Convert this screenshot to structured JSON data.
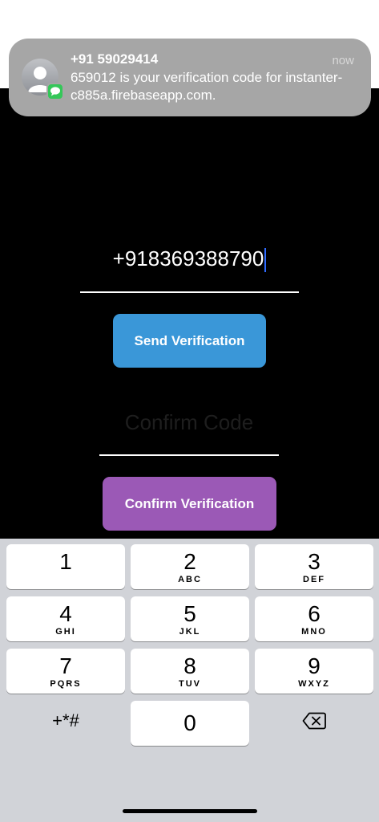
{
  "notification": {
    "sender": "+91 59029414",
    "time": "now",
    "message": "659012 is your verification code for instanter-c885a.firebaseapp.com.",
    "avatar_icon": "contact-avatar-icon",
    "app_badge_icon": "messages-icon"
  },
  "phone": {
    "value": "+918369388790"
  },
  "send_button": {
    "label": "Send Verification",
    "color": "#3a97d8"
  },
  "code": {
    "placeholder": "Confirm Code"
  },
  "confirm_button": {
    "label": "Confirm Verification",
    "color": "#9b59b6"
  },
  "keypad": {
    "keys": [
      {
        "digit": "1",
        "letters": ""
      },
      {
        "digit": "2",
        "letters": "ABC"
      },
      {
        "digit": "3",
        "letters": "DEF"
      },
      {
        "digit": "4",
        "letters": "GHI"
      },
      {
        "digit": "5",
        "letters": "JKL"
      },
      {
        "digit": "6",
        "letters": "MNO"
      },
      {
        "digit": "7",
        "letters": "PQRS"
      },
      {
        "digit": "8",
        "letters": "TUV"
      },
      {
        "digit": "9",
        "letters": "WXYZ"
      }
    ],
    "symbols": "+*#",
    "zero": "0",
    "delete_icon": "backspace-icon"
  }
}
